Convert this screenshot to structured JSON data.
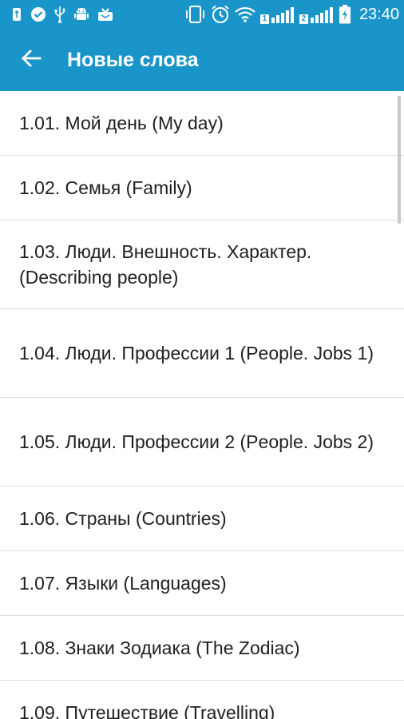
{
  "status_bar": {
    "time": "23:40",
    "sim1_label": "1",
    "sim2_label": "2",
    "left_icons": [
      "usb-icon",
      "check-badge-icon",
      "usb-debug-icon",
      "android-icon",
      "download-tray-icon"
    ],
    "right_icons": [
      "phone-vibrate-icon",
      "alarm-icon",
      "wifi-icon",
      "signal-sim1-icon",
      "signal-sim2-icon",
      "battery-charging-icon"
    ]
  },
  "app_bar": {
    "title": "Новые слова",
    "back_icon": "arrow-back-icon"
  },
  "colors": {
    "primary": "#1a95c9",
    "text": "#202020",
    "divider": "#dedede"
  },
  "list": {
    "items": [
      {
        "label": "1.01. Мой день (My day)"
      },
      {
        "label": "1.02. Семья (Family)"
      },
      {
        "label": "1.03. Люди. Внешность. Характер. (Describing people)"
      },
      {
        "label": "1.04. Люди. Профессии 1 (People. Jobs 1)"
      },
      {
        "label": "1.05. Люди. Профессии 2 (People. Jobs 2)"
      },
      {
        "label": "1.06. Страны (Countries)"
      },
      {
        "label": "1.07. Языки (Languages)"
      },
      {
        "label": "1.08. Знаки Зодиака (The Zodiac)"
      },
      {
        "label": "1.09. Путешествие (Travelling)"
      }
    ]
  }
}
